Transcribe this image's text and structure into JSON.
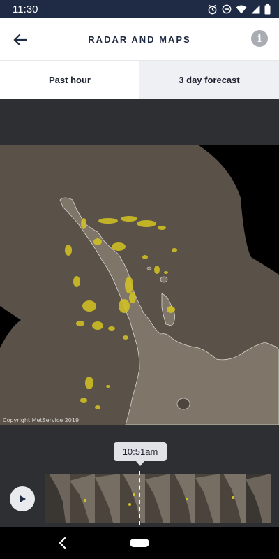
{
  "status_bar": {
    "time": "11:30",
    "icons": [
      "alarm-icon",
      "do-not-disturb-icon",
      "wifi-icon",
      "signal-icon",
      "battery-icon"
    ]
  },
  "header": {
    "title": "RADAR AND MAPS",
    "back_icon": "back-arrow-icon",
    "info_icon": "info-icon",
    "info_glyph": "i"
  },
  "tabs": [
    {
      "label": "Past hour",
      "active": true
    },
    {
      "label": "3 day forecast",
      "active": false
    }
  ],
  "map": {
    "copyright": "Copyright MetService 2019",
    "colors": {
      "land": "#7a7065",
      "radar_background": "#5a5148",
      "outer": "#000000",
      "rain": "#d4c422"
    }
  },
  "timeline": {
    "current_time": "10:51am",
    "play_icon": "play-icon"
  },
  "nav_bar": {
    "back_icon": "nav-back-icon",
    "home_icon": "nav-home-pill"
  }
}
